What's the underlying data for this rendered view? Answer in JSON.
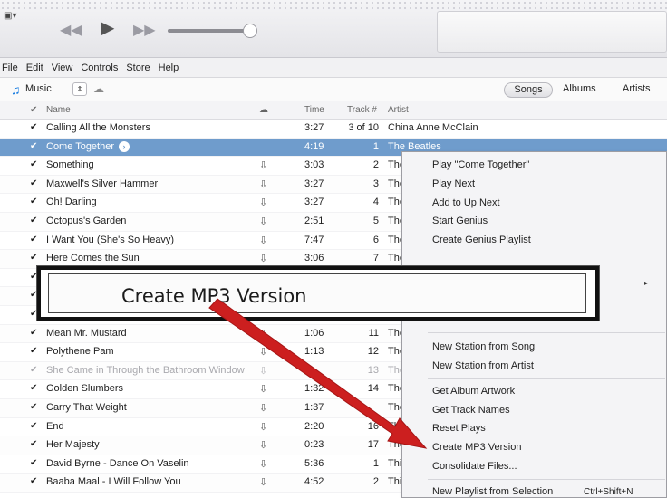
{
  "player": {
    "app_menu_icon": "▣▾",
    "prev_icon": "◀◀",
    "play_icon": "▶",
    "next_icon": "▶▶"
  },
  "menubar": [
    "File",
    "Edit",
    "View",
    "Controls",
    "Store",
    "Help"
  ],
  "source": {
    "music_label": "Music",
    "stepper": "⇕",
    "views": [
      "Songs",
      "Albums",
      "Artists"
    ]
  },
  "columns": {
    "check": "✔",
    "name": "Name",
    "time": "Time",
    "track": "Track #",
    "artist": "Artist"
  },
  "rows": [
    {
      "name": "Calling All the Monsters",
      "time": "3:27",
      "track": "3 of 10",
      "artist": "China Anne McClain",
      "cloud": false
    },
    {
      "name": "Come Together",
      "time": "4:19",
      "track": "1",
      "artist": "The Beatles",
      "selected": true
    },
    {
      "name": "Something",
      "time": "3:03",
      "track": "2",
      "artist": "The",
      "cloud": true
    },
    {
      "name": "Maxwell's Silver Hammer",
      "time": "3:27",
      "track": "3",
      "artist": "The",
      "cloud": true
    },
    {
      "name": "Oh! Darling",
      "time": "3:27",
      "track": "4",
      "artist": "The",
      "cloud": true
    },
    {
      "name": "Octopus's Garden",
      "time": "2:51",
      "track": "5",
      "artist": "The",
      "cloud": true
    },
    {
      "name": "I Want You (She's So Heavy)",
      "time": "7:47",
      "track": "6",
      "artist": "The",
      "cloud": true
    },
    {
      "name": "Here Comes the Sun",
      "time": "3:06",
      "track": "7",
      "artist": "The",
      "cloud": true
    },
    {
      "name": "",
      "time": "",
      "track": "",
      "artist": "",
      "cloud": false
    },
    {
      "name": "",
      "time": "",
      "track": "",
      "artist": "",
      "cloud": false
    },
    {
      "name": "",
      "time": "",
      "track": "",
      "artist": "",
      "cloud": false
    },
    {
      "name": "Mean Mr. Mustard",
      "time": "1:06",
      "track": "11",
      "artist": "The",
      "cloud": true
    },
    {
      "name": "Polythene Pam",
      "time": "1:13",
      "track": "12",
      "artist": "The",
      "cloud": true
    },
    {
      "name": "She Came in Through the Bathroom Window",
      "time": "",
      "track": "13",
      "artist": "The",
      "cloud": true,
      "dim": true
    },
    {
      "name": "Golden Slumbers",
      "time": "1:32",
      "track": "14",
      "artist": "The",
      "cloud": true
    },
    {
      "name": "Carry That Weight",
      "time": "1:37",
      "track": "",
      "artist": "The",
      "cloud": true
    },
    {
      "name": "End",
      "time": "2:20",
      "track": "16",
      "artist": "The",
      "cloud": true
    },
    {
      "name": "Her Majesty",
      "time": "0:23",
      "track": "17",
      "artist": "The",
      "cloud": true
    },
    {
      "name": "David Byrne - Dance On Vaselin",
      "time": "5:36",
      "track": "1",
      "artist": "Thi",
      "cloud": true
    },
    {
      "name": "Baaba Maal - I Will Follow You",
      "time": "4:52",
      "track": "2",
      "artist": "Thi",
      "cloud": true
    }
  ],
  "context_menu": {
    "items": [
      "Play \"Come Together\"",
      "Play Next",
      "Add to Up Next",
      "Start Genius",
      "Create Genius Playlist",
      "New Station from Song",
      "New Station from Artist",
      "Get Album Artwork",
      "Get Track Names",
      "Reset Plays",
      "Create MP3 Version",
      "Consolidate Files...",
      "New Playlist from Selection"
    ],
    "shortcut": "Ctrl+Shift+N",
    "submenu_arrow": "▸"
  },
  "callout": {
    "text": "Create MP3 Version",
    "arrow_color": "#cc1f1f"
  }
}
